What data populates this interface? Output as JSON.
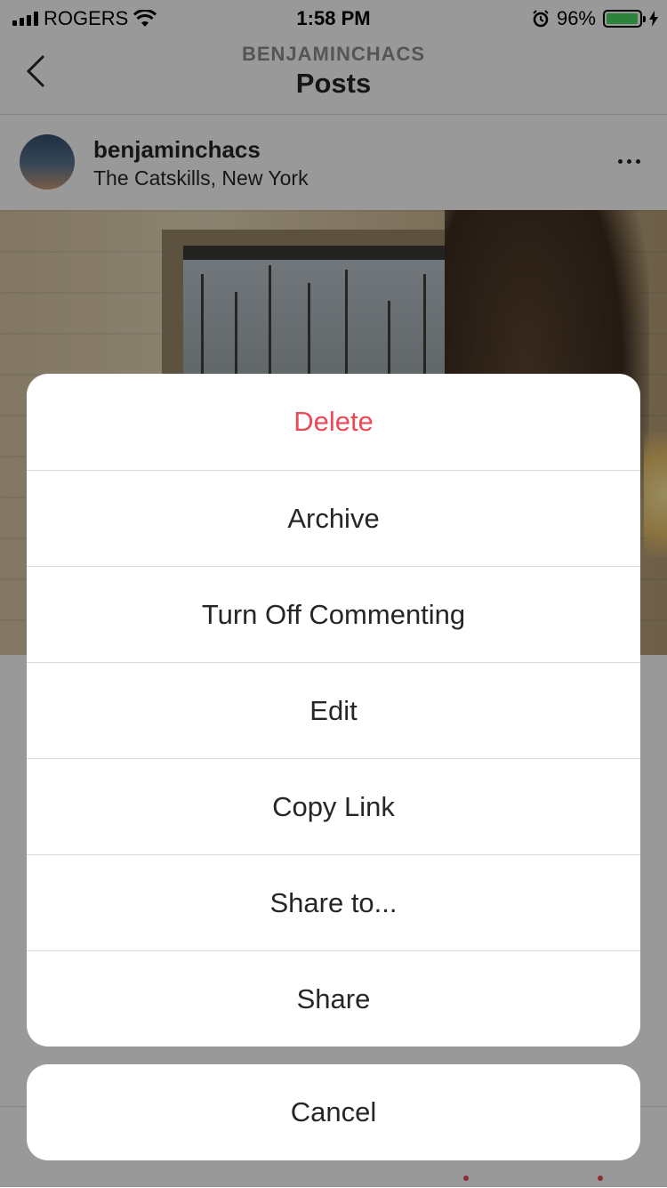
{
  "status_bar": {
    "carrier": "ROGERS",
    "time": "1:58 PM",
    "battery_percent": "96%",
    "battery_level": 0.96,
    "battery_color": "#4cd964"
  },
  "nav": {
    "subtitle": "BENJAMINCHACS",
    "title": "Posts",
    "back_icon": "chevron-left-icon"
  },
  "post": {
    "username": "benjaminchacs",
    "location": "The Catskills, New York",
    "more_icon": "ellipsis-icon"
  },
  "action_sheet": {
    "items": [
      {
        "label": "Delete",
        "destructive": true
      },
      {
        "label": "Archive"
      },
      {
        "label": "Turn Off Commenting"
      },
      {
        "label": "Edit"
      },
      {
        "label": "Copy Link"
      },
      {
        "label": "Share to..."
      },
      {
        "label": "Share"
      }
    ],
    "cancel_label": "Cancel",
    "destructive_color": "#ed4956"
  }
}
